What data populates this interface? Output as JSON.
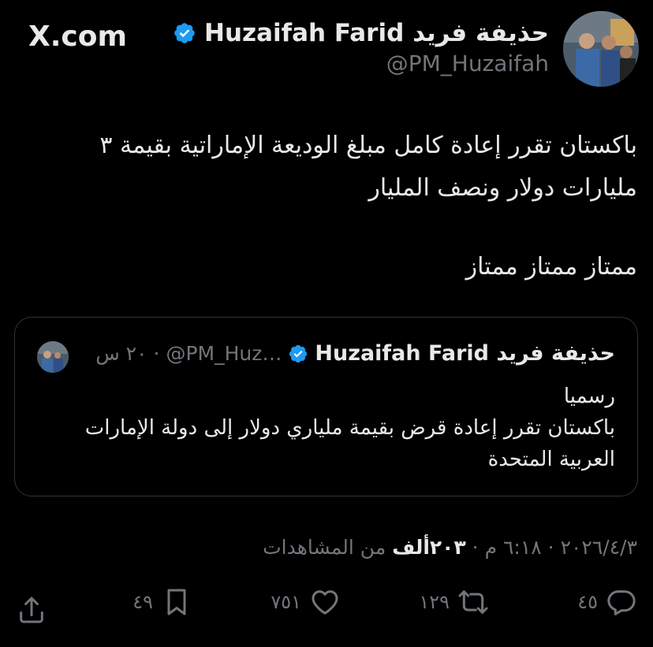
{
  "site_label": "X.com",
  "author": {
    "name": "حذيفة فريد Huzaifah Farid",
    "handle": "@PM_Huzaifah",
    "verified": true
  },
  "tweet": {
    "line1": "باكستان تقرر إعادة كامل مبلغ الوديعة الإماراتية بقيمة ٣",
    "line2": "مليارات دولار ونصف المليار",
    "line3": "ممتاز ممتاز ممتاز"
  },
  "quoted": {
    "name": "حذيفة فريد Huzaifah Farid",
    "handle": "@PM_Huz…",
    "separator": "·",
    "time": "٢٠ س",
    "line1": "رسميا",
    "line2": "باكستان تقرر إعادة قرض بقيمة ملياري دولار إلى دولة الإمارات",
    "line3": "العربية المتحدة"
  },
  "meta": {
    "date": "٢٠٢٦/٤/٣",
    "sep1": "·",
    "time": "٦:١٨ م",
    "sep2": "·",
    "views_count": "٢٠٣ألف",
    "views_label": "من المشاهدات"
  },
  "actions": {
    "reply_count": "٤٥",
    "repost_count": "١٢٩",
    "like_count": "٧٥١",
    "bookmark_count": "٤٩"
  },
  "icons": {
    "verified": "verified-badge-icon",
    "reply": "reply-icon",
    "repost": "repost-icon",
    "like": "heart-icon",
    "bookmark": "bookmark-icon",
    "share": "share-icon"
  },
  "colors": {
    "background": "#000000",
    "text": "#e7e9ea",
    "secondary": "#71767b",
    "verified": "#1d9bf0",
    "border": "#2f3336"
  }
}
